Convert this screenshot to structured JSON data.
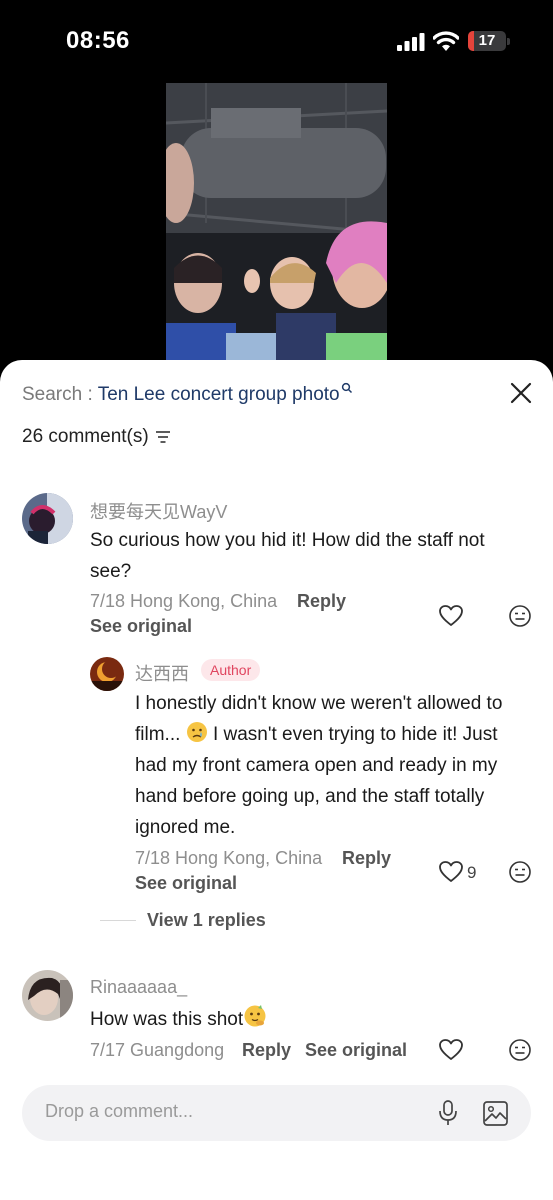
{
  "status_bar": {
    "time": "08:56",
    "battery_level": "17",
    "battery_fraction": 0.17
  },
  "search": {
    "prefix": "Search : ",
    "query": "Ten Lee concert group photo"
  },
  "comments_header": {
    "count_label": "26 comment(s)"
  },
  "comments": [
    {
      "username": "想要每天见WayV",
      "text": "So curious how you hid it! How did the staff not see?",
      "date_location": "7/18 Hong Kong, China",
      "reply_label": "Reply",
      "see_original_label": "See original",
      "reply": {
        "username": "达西西",
        "badge": "Author",
        "text_part1": "I honestly didn't know we weren't allowed to film... ",
        "emoji": "crying-face",
        "text_part2": " I wasn't even trying to hide it! Just had my front camera open and ready in my hand before going up, and the staff totally ignored me.",
        "date_location": "7/18 Hong Kong, China",
        "reply_label": "Reply",
        "see_original_label": "See original",
        "likes": "9"
      },
      "view_replies_label": "View 1 replies"
    },
    {
      "username": "Rinaaaaaa_",
      "text": "How was this shot",
      "emoji": "thinking-face",
      "date_location": "7/17 Guangdong",
      "reply_label": "Reply",
      "see_original_label": "See original"
    }
  ],
  "input": {
    "placeholder": "Drop a comment..."
  },
  "icons": [
    "signal-icon",
    "wifi-icon",
    "battery-icon",
    "search-icon",
    "close-icon",
    "sort-icon",
    "heart-icon",
    "emoji-reaction-icon",
    "microphone-icon",
    "image-icon"
  ],
  "colors": {
    "query": "#1f3a68",
    "author_badge_bg": "#fde7ea",
    "author_badge_text": "#e0455f",
    "battery_fill": "#e5443b"
  }
}
